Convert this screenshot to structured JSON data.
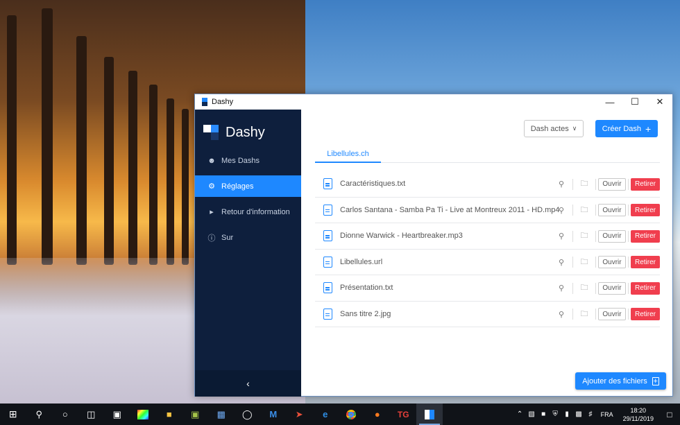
{
  "window": {
    "title": "Dashy"
  },
  "sidebar": {
    "logo": "Dashy",
    "items": [
      {
        "label": "Mes Dashs",
        "icon": "user-icon",
        "active": false
      },
      {
        "label": "Réglages",
        "icon": "gear-icon",
        "active": true
      },
      {
        "label": "Retour d'information",
        "icon": "megaphone-icon",
        "active": false
      },
      {
        "label": "Sur",
        "icon": "info-icon",
        "active": false
      }
    ],
    "collapse_glyph": "‹"
  },
  "header": {
    "dash_actes": "Dash actes",
    "creer": "Créer Dash"
  },
  "tabs": [
    {
      "label": "Libellules.ch"
    }
  ],
  "files": [
    {
      "name": "Caractéristiques.txt"
    },
    {
      "name": "Carlos Santana - Samba Pa Ti - Live at Montreux 2011 - HD.mp4"
    },
    {
      "name": "Dionne Warwick - Heartbreaker.mp3"
    },
    {
      "name": "Libellules.url"
    },
    {
      "name": "Présentation.txt"
    },
    {
      "name": "Sans titre 2.jpg"
    }
  ],
  "row_actions": {
    "open": "Ouvrir",
    "remove": "Retirer"
  },
  "footer": {
    "ajouter": "Ajouter des fichiers"
  },
  "taskbar": {
    "lang": "FRA",
    "time": "18:20",
    "date": "29/11/2019"
  },
  "colors": {
    "accent": "#1e88ff",
    "sidebar": "#0e1f3d",
    "danger": "#f03e4e"
  }
}
